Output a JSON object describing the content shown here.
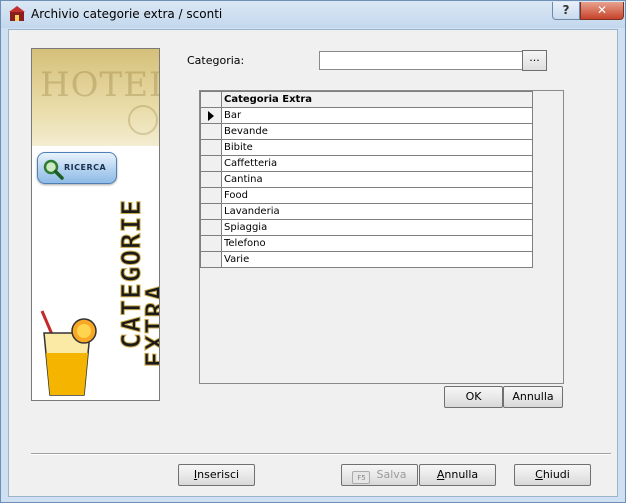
{
  "window": {
    "title": "Archivio categorie extra / sconti",
    "help_label": "?",
    "close_label": "✕"
  },
  "sidebar": {
    "header_text": "HOTEL",
    "search_label": "RICERCA",
    "art_word_1": "CATEGORIE",
    "art_word_2": "EXTRA"
  },
  "form": {
    "categoria_label": "Categoria:",
    "categoria_value": "",
    "browse_label": "..."
  },
  "grid": {
    "header": "Categoria Extra",
    "rows": [
      "Bar",
      "Bevande",
      "Bibite",
      "Caffetteria",
      "Cantina",
      "Food",
      "Lavanderia",
      "Spiaggia",
      "Telefono",
      "Varie"
    ],
    "current_row_index": 0
  },
  "grid_buttons": {
    "ok": "OK",
    "annulla": "Annulla"
  },
  "footer": {
    "inserisci_first": "I",
    "inserisci_rest": "nserisci",
    "salva_badge": "F5",
    "salva": "Salva",
    "annulla_first": "A",
    "annulla_rest": "nnulla",
    "chiudi_first": "C",
    "chiudi_rest": "hiudi"
  },
  "colors": {
    "titlebar": "#c3d7ed",
    "client_bg": "#f0f0f0",
    "close_button": "#c7432a",
    "search_button": "#b3d2f0",
    "sidebar_header": "#e9dca8"
  },
  "icons": {
    "app": "app-icon",
    "search": "magnifier-icon",
    "row_pointer": "row-pointer-icon",
    "drink": "cocktail-icon",
    "save_shortcut": "f5-key-icon"
  }
}
